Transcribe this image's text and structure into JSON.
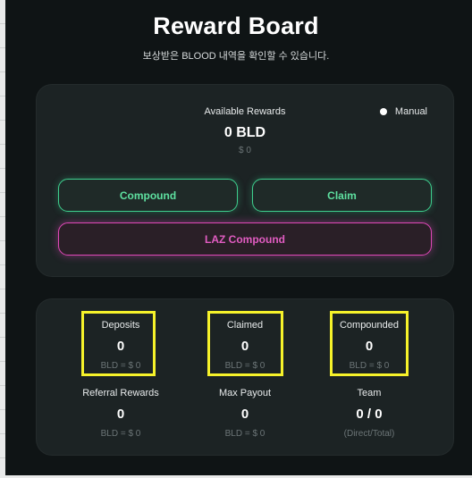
{
  "header": {
    "title": "Reward Board",
    "subtitle": "보상받은 BLOOD 내역을 확인할 수 있습니다."
  },
  "rewards": {
    "available_label": "Available Rewards",
    "available_value": "0 BLD",
    "available_usd": "$ 0",
    "manual_label": "Manual",
    "compound_label": "Compound",
    "claim_label": "Claim",
    "laz_compound_label": "LAZ Compound"
  },
  "stats": [
    {
      "label": "Deposits",
      "value": "0",
      "sub": "BLD = $ 0"
    },
    {
      "label": "Claimed",
      "value": "0",
      "sub": "BLD = $ 0"
    },
    {
      "label": "Compounded",
      "value": "0",
      "sub": "BLD = $ 0"
    },
    {
      "label": "Referral Rewards",
      "value": "0",
      "sub": "BLD = $ 0"
    },
    {
      "label": "Max Payout",
      "value": "0",
      "sub": "BLD = $ 0"
    },
    {
      "label": "Team",
      "value": "0 / 0",
      "sub": "(Direct/Total)"
    }
  ],
  "colors": {
    "accent_green": "#3ecf8e",
    "accent_pink": "#e048b8",
    "highlight_yellow": "#f6f22a"
  }
}
